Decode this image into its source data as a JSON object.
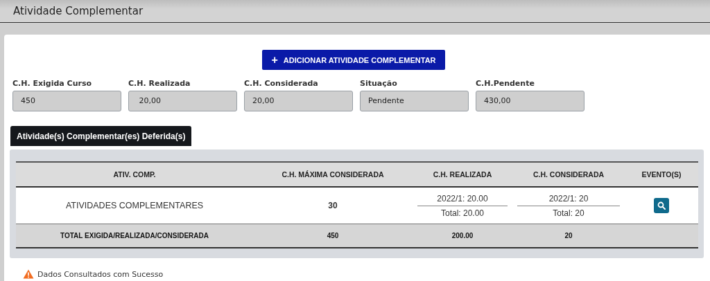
{
  "page": {
    "title": "Atividade Complementar"
  },
  "add_button": {
    "icon": "+",
    "label": "ADICIONAR ATIVIDADE COMPLEMENTAR"
  },
  "summary_fields": [
    {
      "label": "C.H. Exigida Curso",
      "value": "450"
    },
    {
      "label": "C.H. Realizada",
      "value": " 20,00"
    },
    {
      "label": "C.H. Considerada",
      "value": "20,00"
    },
    {
      "label": "Situação",
      "value": "Pendente"
    },
    {
      "label": "C.H.Pendente",
      "value": "430,00"
    }
  ],
  "section_tab": {
    "label": "Atividade(s) Complementar(es) Deferida(s)"
  },
  "table": {
    "columns": [
      "ATIV. COMP.",
      "C.H. MÁXIMA CONSIDERADA",
      "C.H. REALIZADA",
      "C.H. CONSIDERADA",
      "EVENTO(S)"
    ],
    "rows": [
      {
        "activity": "ATIVIDADES COMPLEMENTARES",
        "max_hours": "30",
        "realized": {
          "period": "2022/1: 20.00",
          "total": "Total: 20.00"
        },
        "considered": {
          "period": "2022/1: 20",
          "total": "Total: 20"
        }
      }
    ],
    "total_row": [
      "TOTAL EXIGIDA/REALIZADA/CONSIDERADA",
      "450",
      "200.00",
      "20"
    ]
  },
  "status_message": {
    "kind": "warning",
    "text": "Dados Consultados com Sucesso"
  }
}
